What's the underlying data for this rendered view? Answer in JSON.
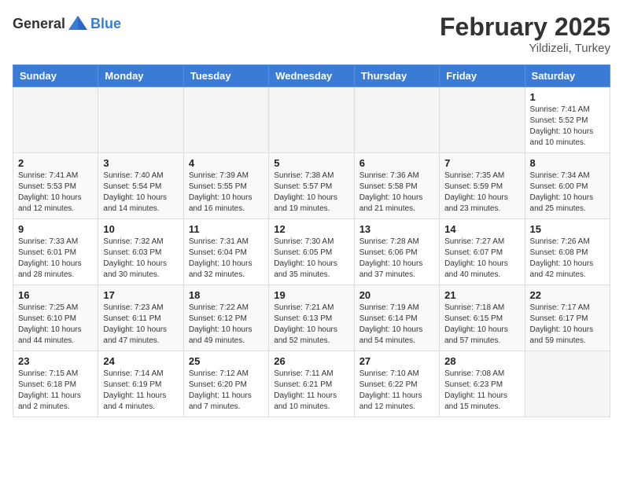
{
  "header": {
    "logo_general": "General",
    "logo_blue": "Blue",
    "month_title": "February 2025",
    "location": "Yildizeli, Turkey"
  },
  "weekdays": [
    "Sunday",
    "Monday",
    "Tuesday",
    "Wednesday",
    "Thursday",
    "Friday",
    "Saturday"
  ],
  "weeks": [
    [
      {
        "day": "",
        "info": ""
      },
      {
        "day": "",
        "info": ""
      },
      {
        "day": "",
        "info": ""
      },
      {
        "day": "",
        "info": ""
      },
      {
        "day": "",
        "info": ""
      },
      {
        "day": "",
        "info": ""
      },
      {
        "day": "1",
        "info": "Sunrise: 7:41 AM\nSunset: 5:52 PM\nDaylight: 10 hours and 10 minutes."
      }
    ],
    [
      {
        "day": "2",
        "info": "Sunrise: 7:41 AM\nSunset: 5:53 PM\nDaylight: 10 hours and 12 minutes."
      },
      {
        "day": "3",
        "info": "Sunrise: 7:40 AM\nSunset: 5:54 PM\nDaylight: 10 hours and 14 minutes."
      },
      {
        "day": "4",
        "info": "Sunrise: 7:39 AM\nSunset: 5:55 PM\nDaylight: 10 hours and 16 minutes."
      },
      {
        "day": "5",
        "info": "Sunrise: 7:38 AM\nSunset: 5:57 PM\nDaylight: 10 hours and 19 minutes."
      },
      {
        "day": "6",
        "info": "Sunrise: 7:36 AM\nSunset: 5:58 PM\nDaylight: 10 hours and 21 minutes."
      },
      {
        "day": "7",
        "info": "Sunrise: 7:35 AM\nSunset: 5:59 PM\nDaylight: 10 hours and 23 minutes."
      },
      {
        "day": "8",
        "info": "Sunrise: 7:34 AM\nSunset: 6:00 PM\nDaylight: 10 hours and 25 minutes."
      }
    ],
    [
      {
        "day": "9",
        "info": "Sunrise: 7:33 AM\nSunset: 6:01 PM\nDaylight: 10 hours and 28 minutes."
      },
      {
        "day": "10",
        "info": "Sunrise: 7:32 AM\nSunset: 6:03 PM\nDaylight: 10 hours and 30 minutes."
      },
      {
        "day": "11",
        "info": "Sunrise: 7:31 AM\nSunset: 6:04 PM\nDaylight: 10 hours and 32 minutes."
      },
      {
        "day": "12",
        "info": "Sunrise: 7:30 AM\nSunset: 6:05 PM\nDaylight: 10 hours and 35 minutes."
      },
      {
        "day": "13",
        "info": "Sunrise: 7:28 AM\nSunset: 6:06 PM\nDaylight: 10 hours and 37 minutes."
      },
      {
        "day": "14",
        "info": "Sunrise: 7:27 AM\nSunset: 6:07 PM\nDaylight: 10 hours and 40 minutes."
      },
      {
        "day": "15",
        "info": "Sunrise: 7:26 AM\nSunset: 6:08 PM\nDaylight: 10 hours and 42 minutes."
      }
    ],
    [
      {
        "day": "16",
        "info": "Sunrise: 7:25 AM\nSunset: 6:10 PM\nDaylight: 10 hours and 44 minutes."
      },
      {
        "day": "17",
        "info": "Sunrise: 7:23 AM\nSunset: 6:11 PM\nDaylight: 10 hours and 47 minutes."
      },
      {
        "day": "18",
        "info": "Sunrise: 7:22 AM\nSunset: 6:12 PM\nDaylight: 10 hours and 49 minutes."
      },
      {
        "day": "19",
        "info": "Sunrise: 7:21 AM\nSunset: 6:13 PM\nDaylight: 10 hours and 52 minutes."
      },
      {
        "day": "20",
        "info": "Sunrise: 7:19 AM\nSunset: 6:14 PM\nDaylight: 10 hours and 54 minutes."
      },
      {
        "day": "21",
        "info": "Sunrise: 7:18 AM\nSunset: 6:15 PM\nDaylight: 10 hours and 57 minutes."
      },
      {
        "day": "22",
        "info": "Sunrise: 7:17 AM\nSunset: 6:17 PM\nDaylight: 10 hours and 59 minutes."
      }
    ],
    [
      {
        "day": "23",
        "info": "Sunrise: 7:15 AM\nSunset: 6:18 PM\nDaylight: 11 hours and 2 minutes."
      },
      {
        "day": "24",
        "info": "Sunrise: 7:14 AM\nSunset: 6:19 PM\nDaylight: 11 hours and 4 minutes."
      },
      {
        "day": "25",
        "info": "Sunrise: 7:12 AM\nSunset: 6:20 PM\nDaylight: 11 hours and 7 minutes."
      },
      {
        "day": "26",
        "info": "Sunrise: 7:11 AM\nSunset: 6:21 PM\nDaylight: 11 hours and 10 minutes."
      },
      {
        "day": "27",
        "info": "Sunrise: 7:10 AM\nSunset: 6:22 PM\nDaylight: 11 hours and 12 minutes."
      },
      {
        "day": "28",
        "info": "Sunrise: 7:08 AM\nSunset: 6:23 PM\nDaylight: 11 hours and 15 minutes."
      },
      {
        "day": "",
        "info": ""
      }
    ]
  ]
}
